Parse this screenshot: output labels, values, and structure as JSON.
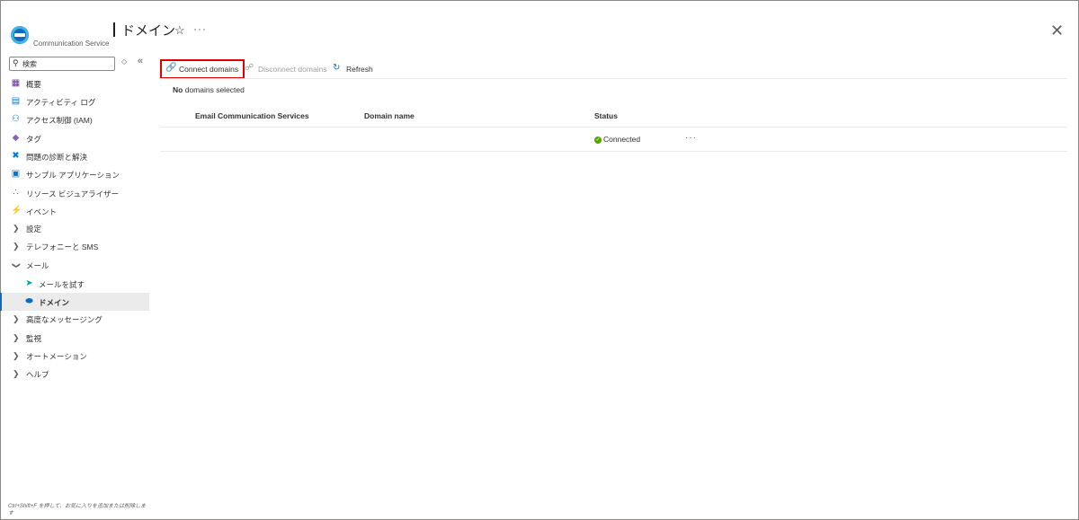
{
  "header": {
    "service_label": "Communication Service",
    "page_title": "ドメイン",
    "favorite_glyph": "☆",
    "more_glyph": "···",
    "close_glyph": "✕"
  },
  "sidebar": {
    "search_placeholder": "検索",
    "items": [
      {
        "label": "概要",
        "icon": "overview-icon",
        "color": "#5c2d91"
      },
      {
        "label": "アクティビティ ログ",
        "icon": "activity-log-icon",
        "color": "#0078d4"
      },
      {
        "label": "アクセス制御 (IAM)",
        "icon": "iam-icon",
        "color": "#0078d4"
      },
      {
        "label": "タグ",
        "icon": "tag-icon",
        "color": "#8764b8"
      },
      {
        "label": "問題の診断と解決",
        "icon": "diagnose-icon",
        "color": "#0078d4"
      },
      {
        "label": "サンプル アプリケーション",
        "icon": "sample-app-icon",
        "color": "#0078d4"
      },
      {
        "label": "リソース ビジュアライザー",
        "icon": "visualizer-icon",
        "color": "#0078d4"
      },
      {
        "label": "イベント",
        "icon": "events-icon",
        "color": "#ffb900"
      },
      {
        "label": "設定",
        "expand": "collapsed"
      },
      {
        "label": "テレフォニーと SMS",
        "expand": "collapsed"
      },
      {
        "label": "メール",
        "expand": "expanded"
      },
      {
        "label": "メールを試す",
        "icon": "try-email-icon",
        "color": "#00a2ad",
        "child": true
      },
      {
        "label": "ドメイン",
        "icon": "domain-icon",
        "color": "#0f6cbd",
        "child": true,
        "selected": true
      },
      {
        "label": "高度なメッセージング",
        "expand": "collapsed"
      },
      {
        "label": "監視",
        "expand": "collapsed"
      },
      {
        "label": "オートメーション",
        "expand": "collapsed"
      },
      {
        "label": "ヘルプ",
        "expand": "collapsed"
      }
    ],
    "footer_hint": "Ctrl+Shift+F を押して、お気に入りを追加または削除します"
  },
  "toolbar": {
    "connect_label": "Connect domains",
    "disconnect_label": "Disconnect domains",
    "refresh_label": "Refresh"
  },
  "selection": {
    "count_word": "No",
    "rest": "domains selected"
  },
  "table": {
    "columns": [
      "Email Communication Services",
      "Domain name",
      "Status"
    ],
    "rows": [
      {
        "service": "",
        "domain": "",
        "status": "Connected",
        "status_color": "#57a300"
      }
    ],
    "row_more": "···"
  },
  "colors": {
    "accent": "#0f6cbd",
    "highlight_border": "#e00000"
  }
}
